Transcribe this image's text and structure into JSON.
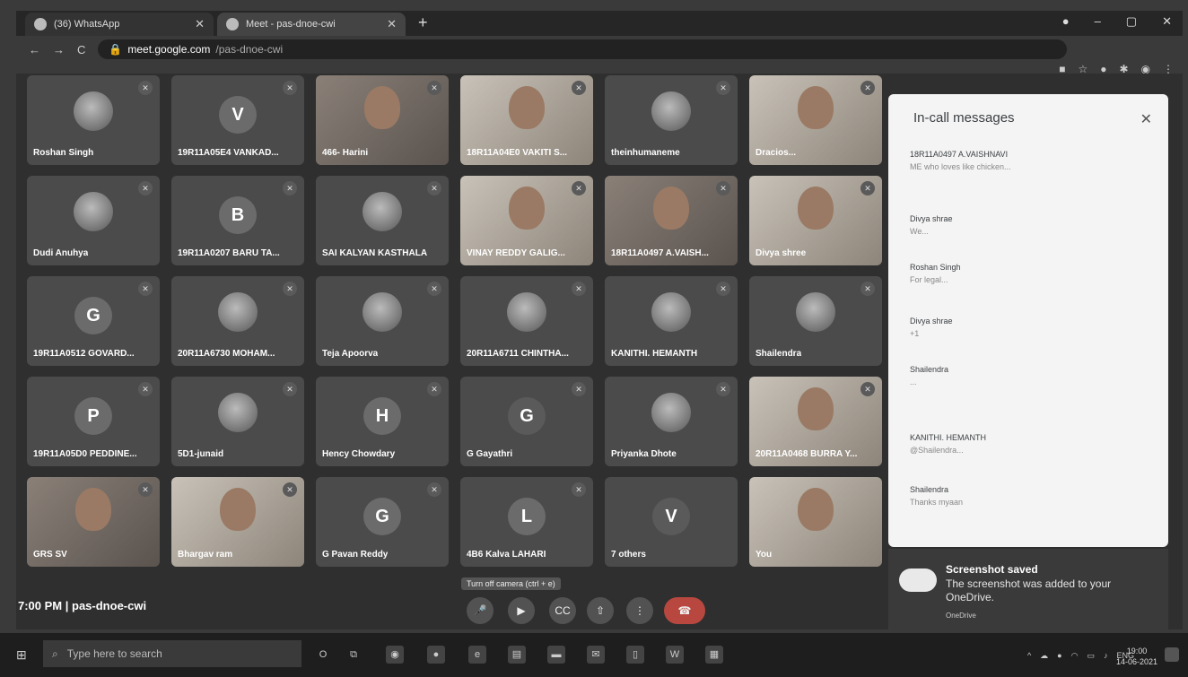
{
  "browser": {
    "tabs": [
      {
        "label": "(36) WhatsApp"
      },
      {
        "label": "Meet - pas-dnoe-cwi"
      }
    ],
    "url_host": "meet.google.com",
    "url_path": "/pas-dnoe-cwi"
  },
  "tiles": [
    {
      "name": "Roshan Singh",
      "kind": "photo"
    },
    {
      "name": "19R11A05E4 VANKAD...",
      "kind": "letter",
      "letter": "V",
      "color": "#6b6b6b"
    },
    {
      "name": "466- Harini",
      "kind": "video"
    },
    {
      "name": "18R11A04E0 VAKITI S...",
      "kind": "video"
    },
    {
      "name": "theinhumaneme",
      "kind": "photo"
    },
    {
      "name": "Dracios...",
      "kind": "video"
    },
    {
      "name": "Dudi Anuhya",
      "kind": "photo"
    },
    {
      "name": "19R11A0207 BARU TA...",
      "kind": "letter",
      "letter": "B",
      "color": "#6b6b6b"
    },
    {
      "name": "SAI KALYAN KASTHALA",
      "kind": "photo"
    },
    {
      "name": "VINAY REDDY GALIG...",
      "kind": "video"
    },
    {
      "name": "18R11A0497 A.VAISH...",
      "kind": "video"
    },
    {
      "name": "Divya shree",
      "kind": "video"
    },
    {
      "name": "19R11A0512 GOVARD...",
      "kind": "letter",
      "letter": "G",
      "color": "#6b6b6b"
    },
    {
      "name": "20R11A6730 MOHAM...",
      "kind": "photo"
    },
    {
      "name": "Teja Apoorva",
      "kind": "photo"
    },
    {
      "name": "20R11A6711 CHINTHA...",
      "kind": "photo"
    },
    {
      "name": "KANITHI. HEMANTH",
      "kind": "photo"
    },
    {
      "name": "Shailendra",
      "kind": "photo"
    },
    {
      "name": "19R11A05D0 PEDDINE...",
      "kind": "letter",
      "letter": "P",
      "color": "#6b6b6b"
    },
    {
      "name": "5D1-junaid",
      "kind": "photo"
    },
    {
      "name": "Hency Chowdary",
      "kind": "letter",
      "letter": "H",
      "color": "#6b6b6b"
    },
    {
      "name": "G Gayathri",
      "kind": "letter",
      "letter": "G",
      "color": "#5a5a5a"
    },
    {
      "name": "Priyanka Dhote",
      "kind": "photo"
    },
    {
      "name": "20R11A0468 BURRA Y...",
      "kind": "video"
    },
    {
      "name": "GRS SV",
      "kind": "video"
    },
    {
      "name": "Bhargav ram",
      "kind": "video"
    },
    {
      "name": "G Pavan Reddy",
      "kind": "letter",
      "letter": "G",
      "color": "#6b6b6b"
    },
    {
      "name": "4B6 Kalva LAHARI",
      "kind": "letter",
      "letter": "L",
      "color": "#6b6b6b"
    },
    {
      "name": "7 others",
      "kind": "letter",
      "letter": "V",
      "color": "#5a5a5a"
    },
    {
      "name": "You",
      "kind": "video"
    }
  ],
  "chat": {
    "title": "In-call messages",
    "messages": [
      {
        "from": "18R11A0497 A.VAISHNAVI",
        "text": "ME who loves like chicken..."
      },
      {
        "from": "Divya shrae",
        "text": "We..."
      },
      {
        "from": "Roshan Singh",
        "text": "For legal..."
      },
      {
        "from": "Divya shrae",
        "text": "+1"
      },
      {
        "from": "Shailendra",
        "text": "..."
      },
      {
        "from": "KANITHI. HEMANTH",
        "text": "@Shailendra..."
      },
      {
        "from": "Shailendra",
        "text": "Thanks myaan"
      }
    ]
  },
  "toast": {
    "heading": "Screenshot saved",
    "body": "The screenshot was added to your OneDrive.",
    "source": "OneDrive"
  },
  "meeting": {
    "time": "7:00 PM",
    "code": "pas-dnoe-cwi",
    "tooltip": "Turn off camera (ctrl + e)"
  },
  "taskbar": {
    "search_placeholder": "Type here to search",
    "lang": "ENG",
    "time": "19:00",
    "date": "14-06-2021"
  }
}
